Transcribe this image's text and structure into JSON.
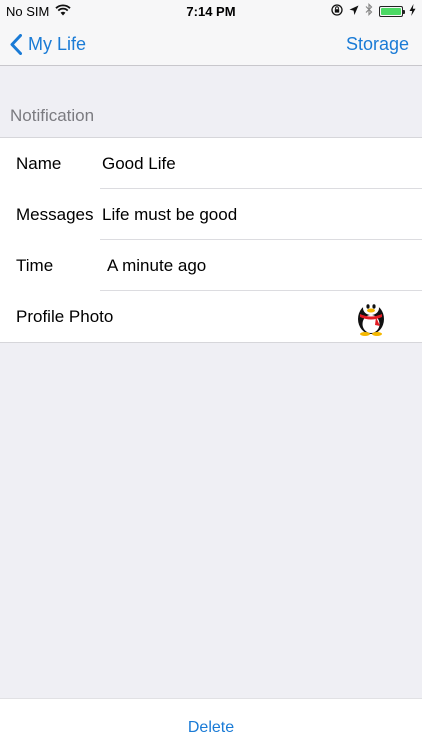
{
  "status_bar": {
    "carrier": "No SIM",
    "time": "7:14 PM"
  },
  "nav": {
    "back_label": "My Life",
    "right_label": "Storage"
  },
  "section": {
    "title": "Notification"
  },
  "rows": [
    {
      "label": "Name",
      "value": "Good Life"
    },
    {
      "label": "Messages",
      "value": "Life must be good"
    },
    {
      "label": "Time",
      "value": "A minute ago"
    },
    {
      "label": "Profile Photo",
      "icon": "penguin-avatar-icon"
    }
  ],
  "bottom": {
    "delete_label": "Delete"
  },
  "colors": {
    "accent": "#1a7bd6",
    "battery": "#4cd964",
    "background": "#efeff4"
  }
}
